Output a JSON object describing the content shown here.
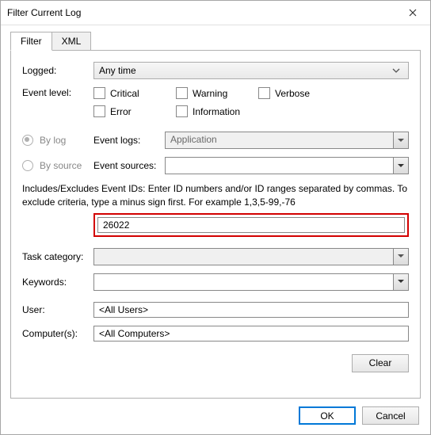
{
  "title": "Filter Current Log",
  "tabs": {
    "filter": "Filter",
    "xml": "XML"
  },
  "labels": {
    "logged": "Logged:",
    "event_level": "Event level:",
    "by_log": "By log",
    "by_source": "By source",
    "event_logs": "Event logs:",
    "event_sources": "Event sources:",
    "task_category": "Task category:",
    "keywords": "Keywords:",
    "user": "User:",
    "computers": "Computer(s):"
  },
  "logged_value": "Any time",
  "levels": {
    "critical": "Critical",
    "warning": "Warning",
    "verbose": "Verbose",
    "error": "Error",
    "information": "Information"
  },
  "event_logs_value": "Application",
  "event_sources_value": "",
  "help_text": "Includes/Excludes Event IDs: Enter ID numbers and/or ID ranges separated by commas. To exclude criteria, type a minus sign first. For example 1,3,5-99,-76",
  "event_id_value": "26022",
  "task_category_value": "",
  "keywords_value": "",
  "user_value": "<All Users>",
  "computers_value": "<All Computers>",
  "buttons": {
    "clear": "Clear",
    "ok": "OK",
    "cancel": "Cancel"
  }
}
